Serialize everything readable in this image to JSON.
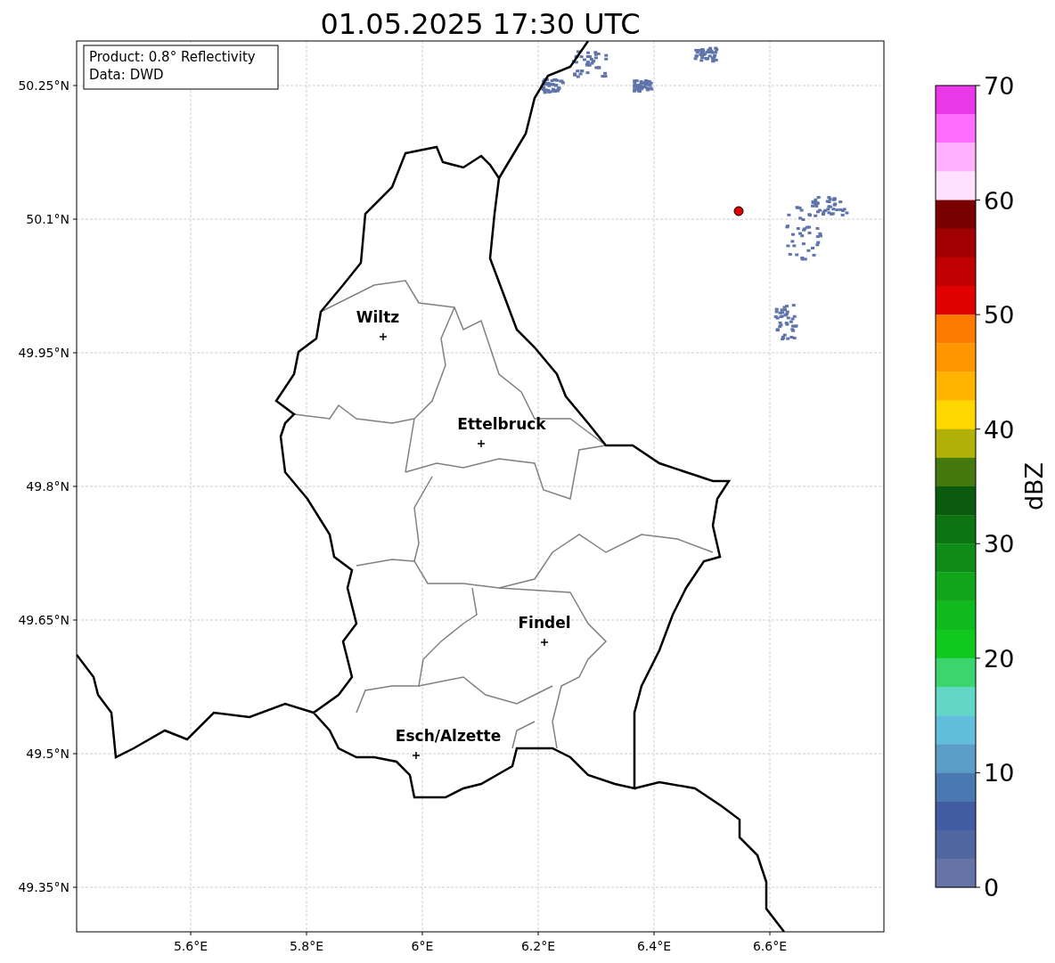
{
  "title": "01.05.2025 17:30 UTC",
  "annotation": [
    "Product: 0.8° Reflectivity",
    "Data: DWD"
  ],
  "map": {
    "x_ticks": [
      "5.6°E",
      "5.8°E",
      "6°E",
      "6.2°E",
      "6.4°E",
      "6.6°E"
    ],
    "y_ticks": [
      "50.25°N",
      "50.1°N",
      "49.95°N",
      "49.8°N",
      "49.65°N",
      "49.5°N",
      "49.35°N"
    ],
    "cities": [
      {
        "name": "Wiltz"
      },
      {
        "name": "Ettelbruck"
      },
      {
        "name": "Findel"
      },
      {
        "name": "Esch/Alzette"
      }
    ]
  },
  "colorbar": {
    "label": "dBZ",
    "ticks": [
      "70",
      "60",
      "50",
      "40",
      "30",
      "20",
      "10",
      "0"
    ],
    "bins": [
      {
        "color": "#e838e8"
      },
      {
        "color": "#ff6cff"
      },
      {
        "color": "#ffb0ff"
      },
      {
        "color": "#ffe0ff"
      },
      {
        "color": "#7a0000"
      },
      {
        "color": "#a00000"
      },
      {
        "color": "#c00000"
      },
      {
        "color": "#e00000"
      },
      {
        "color": "#ff7b00"
      },
      {
        "color": "#ff9600"
      },
      {
        "color": "#ffb500"
      },
      {
        "color": "#ffd700"
      },
      {
        "color": "#b1b10a"
      },
      {
        "color": "#447a0d"
      },
      {
        "color": "#0b5b0e"
      },
      {
        "color": "#0d7412"
      },
      {
        "color": "#0f8c18"
      },
      {
        "color": "#10a51a"
      },
      {
        "color": "#10b91e"
      },
      {
        "color": "#10c81e"
      },
      {
        "color": "#3cd46c"
      },
      {
        "color": "#64d6c6"
      },
      {
        "color": "#62bfdc"
      },
      {
        "color": "#5b9dc6"
      },
      {
        "color": "#4a78b0"
      },
      {
        "color": "#415ca1"
      },
      {
        "color": "#4f66a0"
      },
      {
        "color": "#6573a6"
      }
    ]
  }
}
